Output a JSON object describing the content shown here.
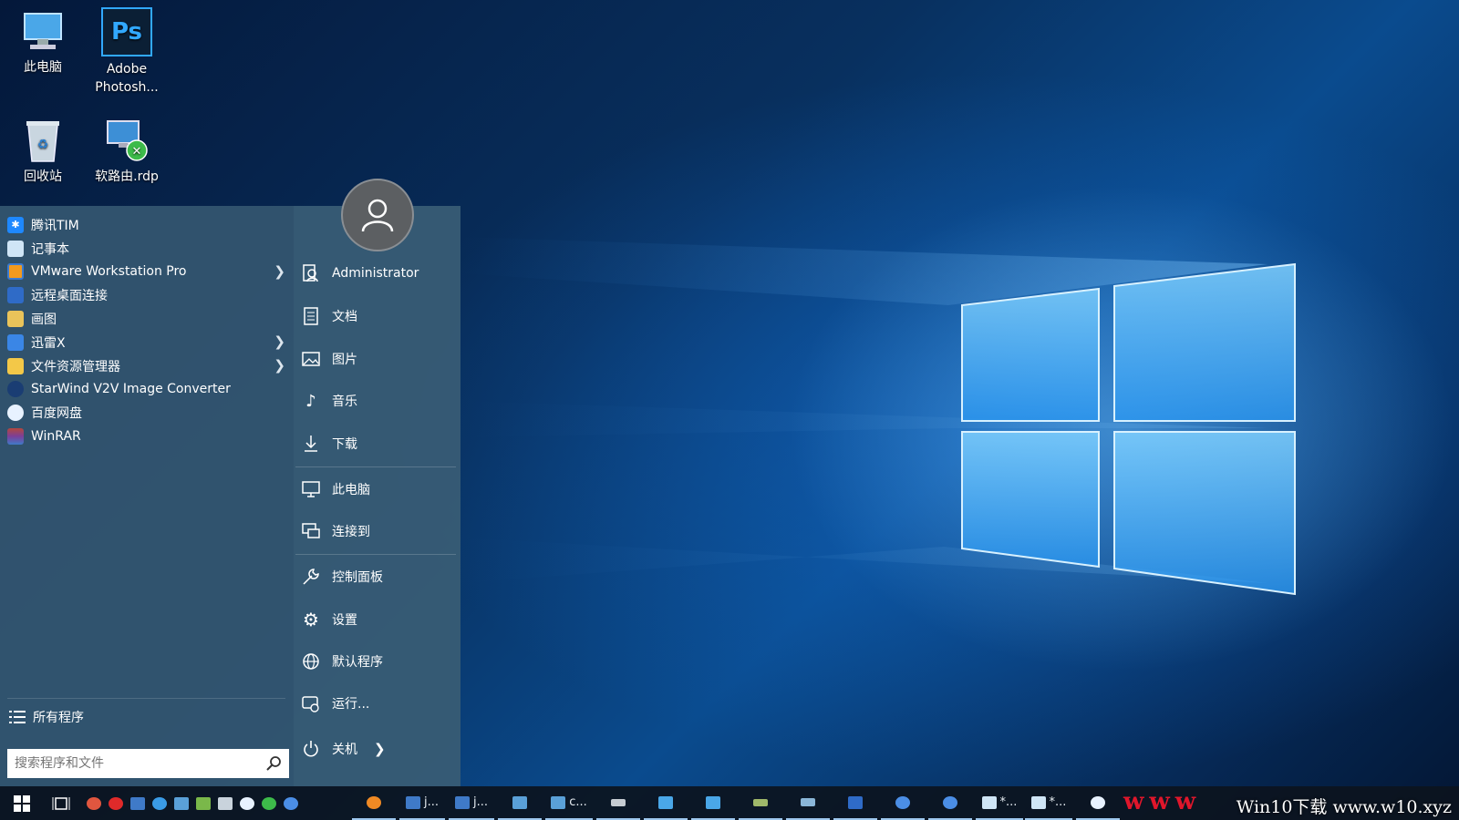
{
  "desktop": {
    "icons": [
      {
        "label": "此电脑",
        "icon": "computer-icon"
      },
      {
        "label": "Adobe Photosh...",
        "icon": "photoshop-icon",
        "glyph": "Ps"
      },
      {
        "label": "回收站",
        "icon": "recycle-bin-icon"
      },
      {
        "label": "软路由.rdp",
        "icon": "remote-desktop-icon"
      }
    ]
  },
  "start_menu": {
    "programs": [
      {
        "label": "腾讯TIM",
        "icon": "tim-icon",
        "has_submenu": false
      },
      {
        "label": "记事本",
        "icon": "notepad-icon",
        "has_submenu": false
      },
      {
        "label": "VMware Workstation Pro",
        "icon": "vmware-icon",
        "has_submenu": true
      },
      {
        "label": "远程桌面连接",
        "icon": "remote-desktop-icon",
        "has_submenu": false
      },
      {
        "label": "画图",
        "icon": "paint-icon",
        "has_submenu": false
      },
      {
        "label": "迅雷X",
        "icon": "xunlei-icon",
        "has_submenu": true
      },
      {
        "label": "文件资源管理器",
        "icon": "folder-icon",
        "has_submenu": true
      },
      {
        "label": "StarWind V2V Image Converter",
        "icon": "starwind-icon",
        "has_submenu": false
      },
      {
        "label": "百度网盘",
        "icon": "baidu-netdisk-icon",
        "has_submenu": false
      },
      {
        "label": "WinRAR",
        "icon": "winrar-icon",
        "has_submenu": false
      }
    ],
    "all_programs": "所有程序",
    "search_placeholder": "搜索程序和文件",
    "user_name": "Administrator",
    "places": [
      {
        "label": "文档",
        "icon": "document-icon"
      },
      {
        "label": "图片",
        "icon": "picture-icon"
      },
      {
        "label": "音乐",
        "icon": "music-icon"
      },
      {
        "label": "下载",
        "icon": "download-icon"
      },
      {
        "label": "此电脑",
        "icon": "computer-icon"
      },
      {
        "label": "连接到",
        "icon": "connect-icon"
      },
      {
        "label": "控制面板",
        "icon": "wrench-icon"
      },
      {
        "label": "设置",
        "icon": "gear-icon"
      },
      {
        "label": "默认程序",
        "icon": "globe-icon"
      },
      {
        "label": "运行...",
        "icon": "run-icon"
      }
    ],
    "shutdown": "关机"
  },
  "taskbar": {
    "running": [
      {
        "label": "j...",
        "icon": "remote-desktop-icon"
      },
      {
        "label": "j...",
        "icon": "remote-desktop-icon"
      },
      {
        "label": "c...",
        "icon": "network-icon"
      },
      {
        "label": "*...",
        "icon": "notepad-icon"
      },
      {
        "label": "*...",
        "icon": "notepad-icon"
      }
    ],
    "watermark": "Win10下载 www.w10.xyz",
    "watermark_red": "www"
  },
  "colors": {
    "accent": "#1a8cff",
    "start_menu_bg": "#345670",
    "taskbar_bg": "#0c141e"
  }
}
